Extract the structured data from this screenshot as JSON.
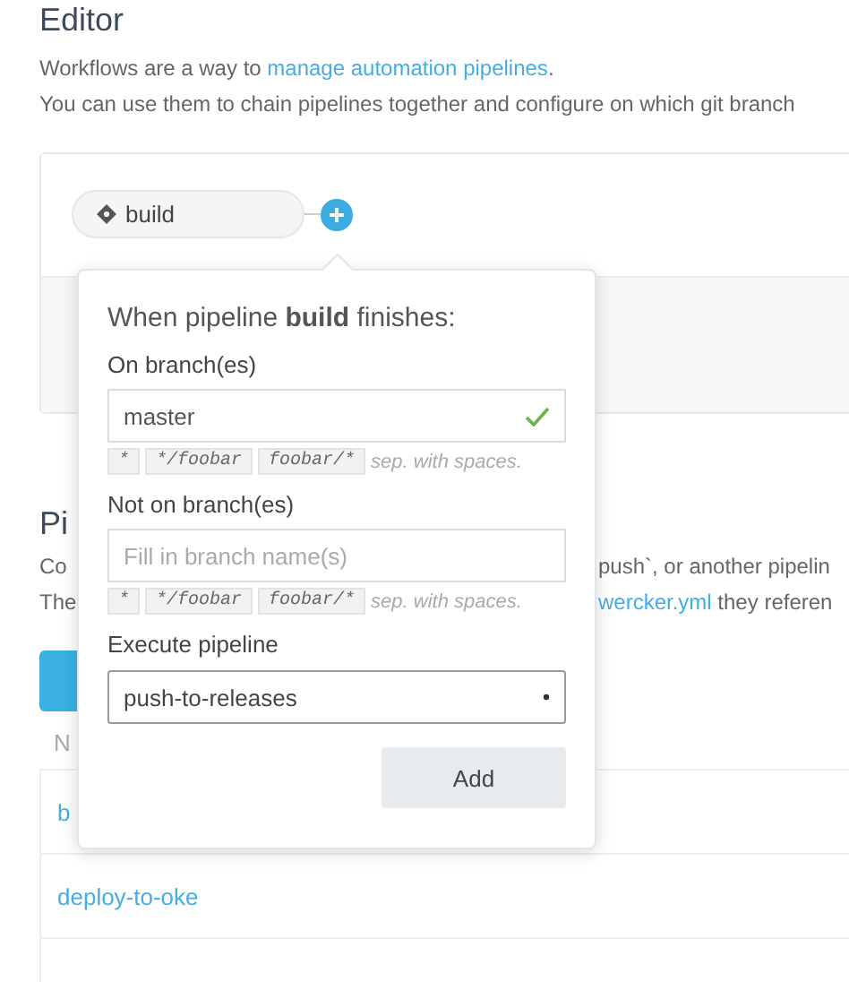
{
  "editor": {
    "title": "Editor",
    "intro_line_1": {
      "before": "Workflows are a way to ",
      "link": "manage automation pipelines",
      "after": "."
    },
    "intro_line_2": "You can use them to chain pipelines together and configure on which git branch"
  },
  "workflow": {
    "nodes": [
      {
        "label": "build"
      }
    ]
  },
  "popup": {
    "heading": "When pipeline **build** finishes:",
    "fields": [
      {
        "kind": "text",
        "label": "On branch(es)",
        "value": "master",
        "valid": true,
        "hints": [
          "*",
          "*/foobar",
          "foobar/*"
        ],
        "hint_note": "sep. with spaces."
      },
      {
        "kind": "text",
        "label": "Not on branch(es)",
        "placeholder": "Fill in branch name(s)",
        "valid": false,
        "hints": [
          "*",
          "*/foobar",
          "foobar/*"
        ],
        "hint_note": "sep. with spaces."
      },
      {
        "kind": "select",
        "label": "Execute pipeline",
        "value": "push-to-releases"
      }
    ],
    "submit": "Add"
  },
  "pipelines": {
    "heading": "Pi",
    "desc_lines": [
      {
        "left": "Co",
        "right": "push`, or another pipelin"
      },
      {
        "left": "The",
        "link": "wercker.yml",
        "right": " they referen"
      }
    ],
    "column_header": "N",
    "rows": [
      "b",
      "deploy-to-oke"
    ]
  }
}
